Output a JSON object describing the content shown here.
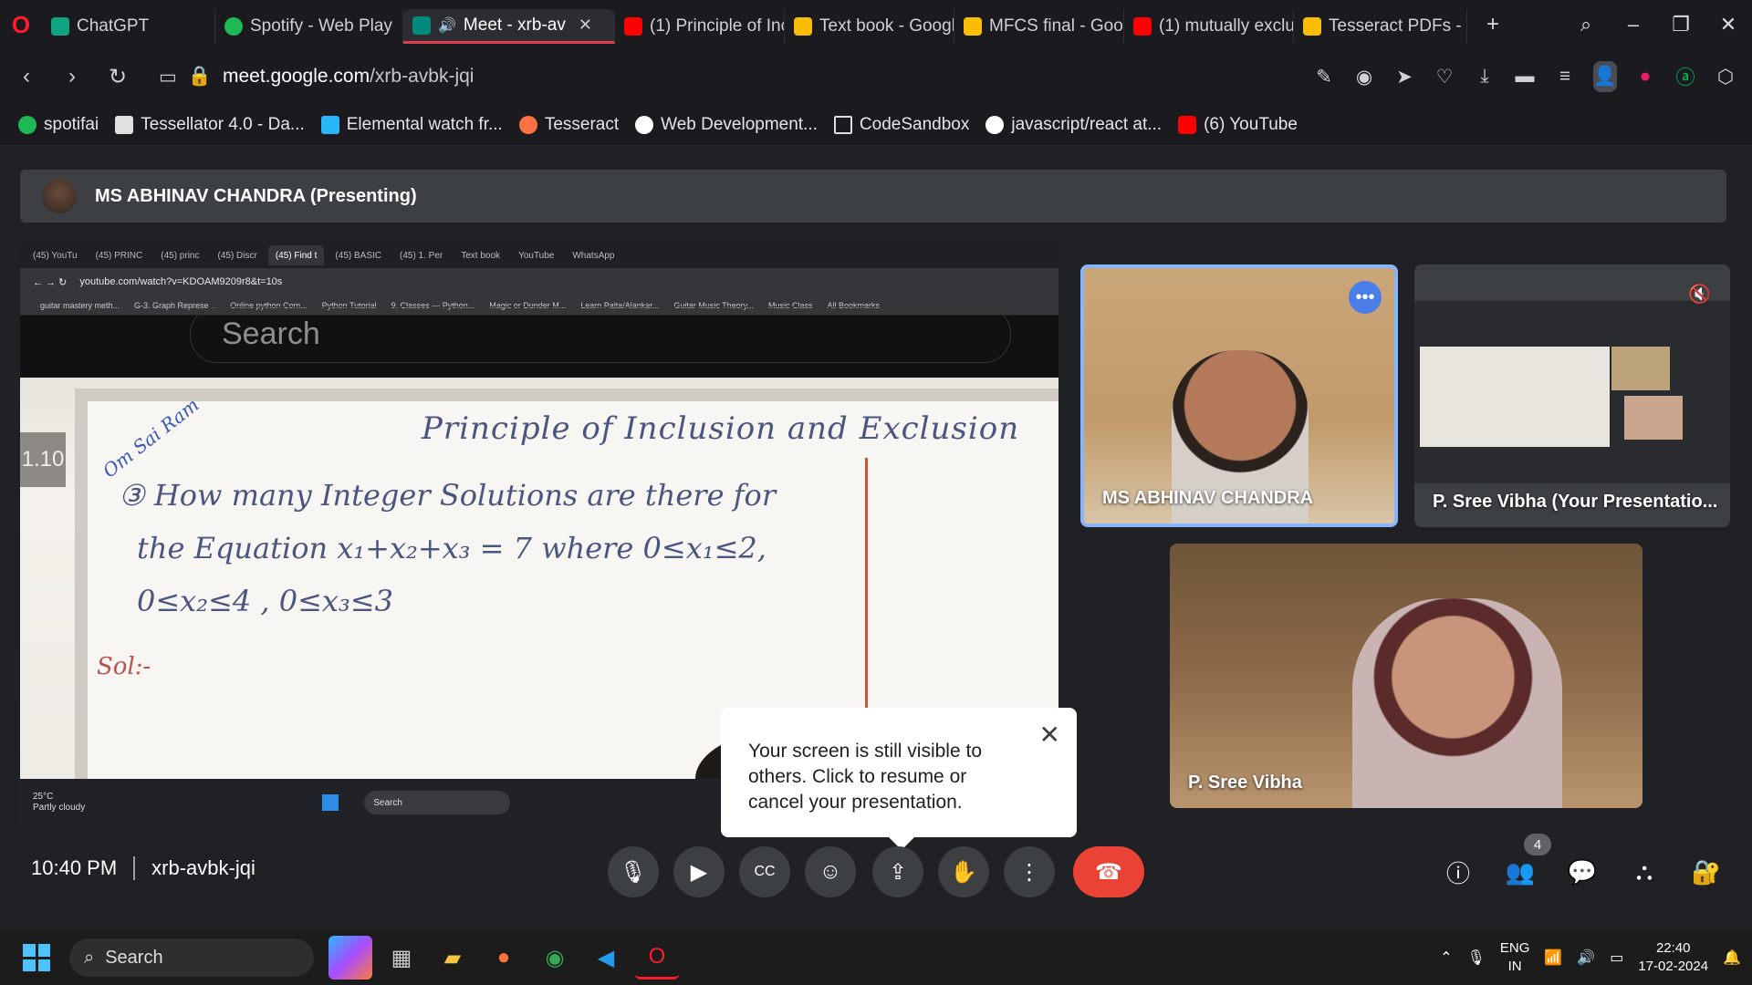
{
  "browser": {
    "tabs": [
      {
        "label": "ChatGPT",
        "color": "#10a37f"
      },
      {
        "label": "Spotify - Web Play",
        "color": "#1db954"
      },
      {
        "label": "Meet - xrb-av",
        "color": "#00897b",
        "active": true
      },
      {
        "label": "(1) Principle of Inc",
        "color": "#ff0000"
      },
      {
        "label": "Text book - Googl",
        "color": "#fbbc04"
      },
      {
        "label": "MFCS final - Goog",
        "color": "#fbbc04"
      },
      {
        "label": "(1) mutually exclus",
        "color": "#ff0000"
      },
      {
        "label": "Tesseract PDFs - G",
        "color": "#fbbc04"
      }
    ],
    "url_host": "meet.google.com",
    "url_path": "/xrb-avbk-jqi",
    "bookmarks": [
      {
        "label": "spotifai",
        "color": "#1db954"
      },
      {
        "label": "Tessellator 4.0 - Da...",
        "color": "#e0e0e0"
      },
      {
        "label": "Elemental watch fr...",
        "color": "#29b6f6"
      },
      {
        "label": "Tesseract",
        "color": "#ff7043"
      },
      {
        "label": "Web Development...",
        "color": "#ffffff"
      },
      {
        "label": "CodeSandbox",
        "color": "#1b1b1f"
      },
      {
        "label": "javascript/react at...",
        "color": "#ffffff"
      },
      {
        "label": "(6) YouTube",
        "color": "#ff0000"
      }
    ]
  },
  "meet": {
    "presenter_label": "MS ABHINAV CHANDRA (Presenting)",
    "time": "10:40 PM",
    "meeting_code": "xrb-avbk-jqi",
    "participant_count": "4",
    "tiles": [
      {
        "name": "MS ABHINAV CHANDRA"
      },
      {
        "name": "P. Sree Vibha (Your Presentatio..."
      },
      {
        "name": "P. Sree Vibha"
      }
    ],
    "popup_text": "Your screen is still visible to others. Click to resume or cancel your presentation."
  },
  "shared_screen": {
    "inner_tabs": [
      "(45) YouTu",
      "(45) PRINC",
      "(45) princ",
      "(45) Discr",
      "(45) Find t",
      "(45) BASIC",
      "(45) 1. Per",
      "Text book",
      "YouTube",
      "WhatsApp"
    ],
    "inner_url": "youtube.com/watch?v=KDOAM9209r8&t=10s",
    "inner_bookmarks": [
      "guitar mastery meth...",
      "G-3. Graph Represe...",
      "Online python Com...",
      "Python Tutorial",
      "9. Classes — Python...",
      "Magic or Dunder M...",
      "Learn Palta/Alankar...",
      "Guitar Music Theory...",
      "Music Class",
      "All Bookmarks"
    ],
    "search_placeholder": "Search",
    "timestamp": "1.10",
    "board_tag": "Om Sai Ram",
    "board_title": "Principle of Inclusion and Exclusion",
    "board_line1": "③ How many Integer Solutions are there for",
    "board_line2": "the Equation   x₁+x₂+x₃ = 7    where  0≤x₁≤2,",
    "board_line3": "0≤x₂≤4 ,  0≤x₃≤3",
    "board_sol": "Sol:-",
    "weather_temp": "25°C",
    "weather_desc": "Partly cloudy",
    "taskbar_search": "Search"
  },
  "taskbar": {
    "search": "Search",
    "lang_top": "ENG",
    "lang_bottom": "IN",
    "clock_time": "22:40",
    "clock_date": "17-02-2024"
  },
  "accent": "#8ab4f8",
  "end_call_color": "#ea4335"
}
